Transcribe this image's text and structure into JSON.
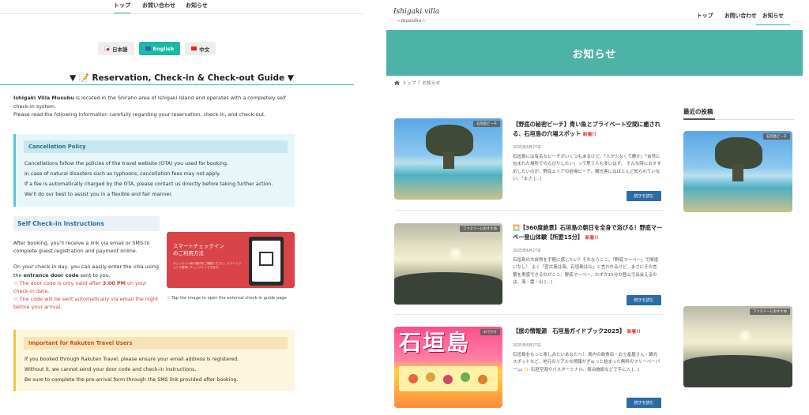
{
  "left": {
    "nav": [
      "トップ",
      "お問い合わせ",
      "お知らせ"
    ],
    "languages": [
      {
        "label": "日本語",
        "flag_color": "#e60012",
        "active": false
      },
      {
        "label": "English",
        "flag_color": "#3c5aa6",
        "active": true
      },
      {
        "label": "中文",
        "flag_color": "#de2910",
        "active": false
      }
    ],
    "guide_title": "▼ 📝 Reservation, Check-in & Check-out Guide ▼",
    "intro": {
      "brand": "Ishigaki Villa Musubu",
      "line1_rest": " is located in the Shiraho area of Ishigaki Island and operates with a completely self check-in system.",
      "line2": "Please read the following information carefully regarding your reservation, check-in, and check-out."
    },
    "cancellation": {
      "title": "Cancellation Policy",
      "lines": [
        "Cancellations follow the policies of the travel website (OTA) you used for booking.",
        "In case of natural disasters such as typhoons, cancellation fees may not apply.",
        "If a fee is automatically charged by the OTA, please contact us directly before taking further action.",
        "We'll do our best to assist you in a flexible and fair manner."
      ]
    },
    "self_checkin": {
      "title": "Self Check-in Instructions",
      "p1": "After booking, you'll receive a link via email or SMS to complete guest registration and payment online.",
      "p2_a": "On your check-in day, you can easily enter the villa using the ",
      "p2_b": "entrance door code",
      "p2_c": " sent to you.",
      "note1_a": "☆ The door code is only valid after ",
      "note1_b": "3:00 PM",
      "note1_c": " on your check-in date.",
      "note2": "☆ The code will be sent automatically via email the night before your arrival.",
      "image_text1": "スマートチェックイン",
      "image_text2": "のご利用方法",
      "image_small": "チェックイン前の案内をご確認ください。スマートフォンで簡単にチェックインできます。",
      "caption": "☆ Tap the image to open the external check-in guide page"
    },
    "rakuten": {
      "title": "Important for Rakuten Travel Users",
      "lines": [
        "If you booked through Rakuten Travel, please ensure your email address is registered.",
        "Without it, we cannot send your door code and check-in instructions.",
        "Be sure to complete the pre-arrival form through the SMS link provided after booking."
      ]
    }
  },
  "right": {
    "logo": "Ishigaki villa",
    "logo_sub": "~musubu~",
    "nav": [
      "トップ",
      "お問い合わせ",
      "お知らせ"
    ],
    "banner_title": "お知らせ",
    "breadcrumb": {
      "home": "トップ",
      "sep": "/",
      "current": "お知らせ"
    },
    "posts": [
      {
        "tag": "石垣島ビーチ",
        "title": "【野底の秘密ビーチ】青い魚とプライベート空間に癒される、石垣島の穴場スポット",
        "new_label": "新着!!",
        "date": "2025年4月27日",
        "excerpt": "石垣島には有名なビーチがいくつもあるけど、「人が少なくて静か」「自然に包まれた場所でのんびりしたい」って思う人も多いはず。 そんな時におすすめしたいのが、野底エリアの岩場ビーチ。観光客にはほとんど知られていない、〝まさ [...]",
        "more": "続きを読む"
      },
      {
        "tag": "ファミリーにおすすめ",
        "title": "🌅【360度絶景】石垣島の朝日を全身で浴びる！野底マーペー登山体験【所要15分】",
        "new_label": "新着!!",
        "date": "2025年4月27日",
        "excerpt": "石垣島の大自然を手軽に感じたい？それならここ、「野底マーペー」で間違いなし！ よく「宮古島は海、石垣島は山」と言われるけど、まさにその言葉を実感できるのがここ、野底マーペー。わずか15分の登山で出会えるのは、海・雲・山 [...]",
        "more": "続きを読む"
      },
      {
        "tag": "おでかけ",
        "title": "【旅の情報源　石垣島ガイドブック2025】",
        "new_label": "新着!!",
        "date": "2025年4月27日",
        "excerpt": "石垣島をもっと楽しみたいあなたへ！ 島内の飲食店・お土産屋さん・観光スポットなど、地元のリアルな情報がぎゅっと詰まった無料のフリーペーパー📖 ✨ 石垣空港やバスターミナル、宿泊施設などで手に入 [...]",
        "more": "続きを読む",
        "guide_big": "石垣島"
      }
    ],
    "sidebar": {
      "title": "最近の投稿",
      "tags": [
        "石垣島ビーチ",
        "ファミリーにおすすめ"
      ]
    }
  }
}
